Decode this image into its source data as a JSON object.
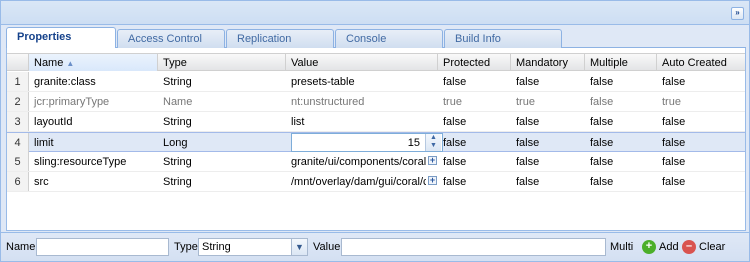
{
  "tabs": [
    {
      "label": "Properties",
      "active": true
    },
    {
      "label": "Access Control",
      "active": false
    },
    {
      "label": "Replication",
      "active": false
    },
    {
      "label": "Console",
      "active": false
    },
    {
      "label": "Build Info",
      "active": false
    }
  ],
  "grid": {
    "columns": [
      "Name",
      "Type",
      "Value",
      "Protected",
      "Mandatory",
      "Multiple",
      "Auto Created"
    ],
    "sort_column": "Name",
    "rows": [
      {
        "num": "1",
        "name": "granite:class",
        "type": "String",
        "value": "presets-table",
        "protected": "false",
        "mandatory": "false",
        "multiple": "false",
        "auto_created": "false"
      },
      {
        "num": "2",
        "name": "jcr:primaryType",
        "type": "Name",
        "value": "nt:unstructured",
        "protected": "true",
        "mandatory": "true",
        "multiple": "false",
        "auto_created": "true"
      },
      {
        "num": "3",
        "name": "layoutId",
        "type": "String",
        "value": "list",
        "protected": "false",
        "mandatory": "false",
        "multiple": "false",
        "auto_created": "false"
      },
      {
        "num": "4",
        "name": "limit",
        "type": "Long",
        "value": "15",
        "protected": "false",
        "mandatory": "false",
        "multiple": "false",
        "auto_created": "false"
      },
      {
        "num": "5",
        "name": "sling:resourceType",
        "type": "String",
        "value": "granite/ui/components/coral/...",
        "protected": "false",
        "mandatory": "false",
        "multiple": "false",
        "auto_created": "false"
      },
      {
        "num": "6",
        "name": "src",
        "type": "String",
        "value": "/mnt/overlay/dam/gui/coral/c...",
        "protected": "false",
        "mandatory": "false",
        "multiple": "false",
        "auto_created": "false"
      }
    ]
  },
  "bottom": {
    "name_label": "Name",
    "name_value": "",
    "type_label": "Type",
    "type_value": "String",
    "value_label": "Value",
    "value_value": "",
    "multi_label": "Multi",
    "add_label": "Add",
    "clear_label": "Clear"
  },
  "colors": {
    "accent": "#99bbe8",
    "selected_row": "#dfe8f6",
    "add_green": "#4caf2a",
    "clear_red": "#d9534f"
  }
}
